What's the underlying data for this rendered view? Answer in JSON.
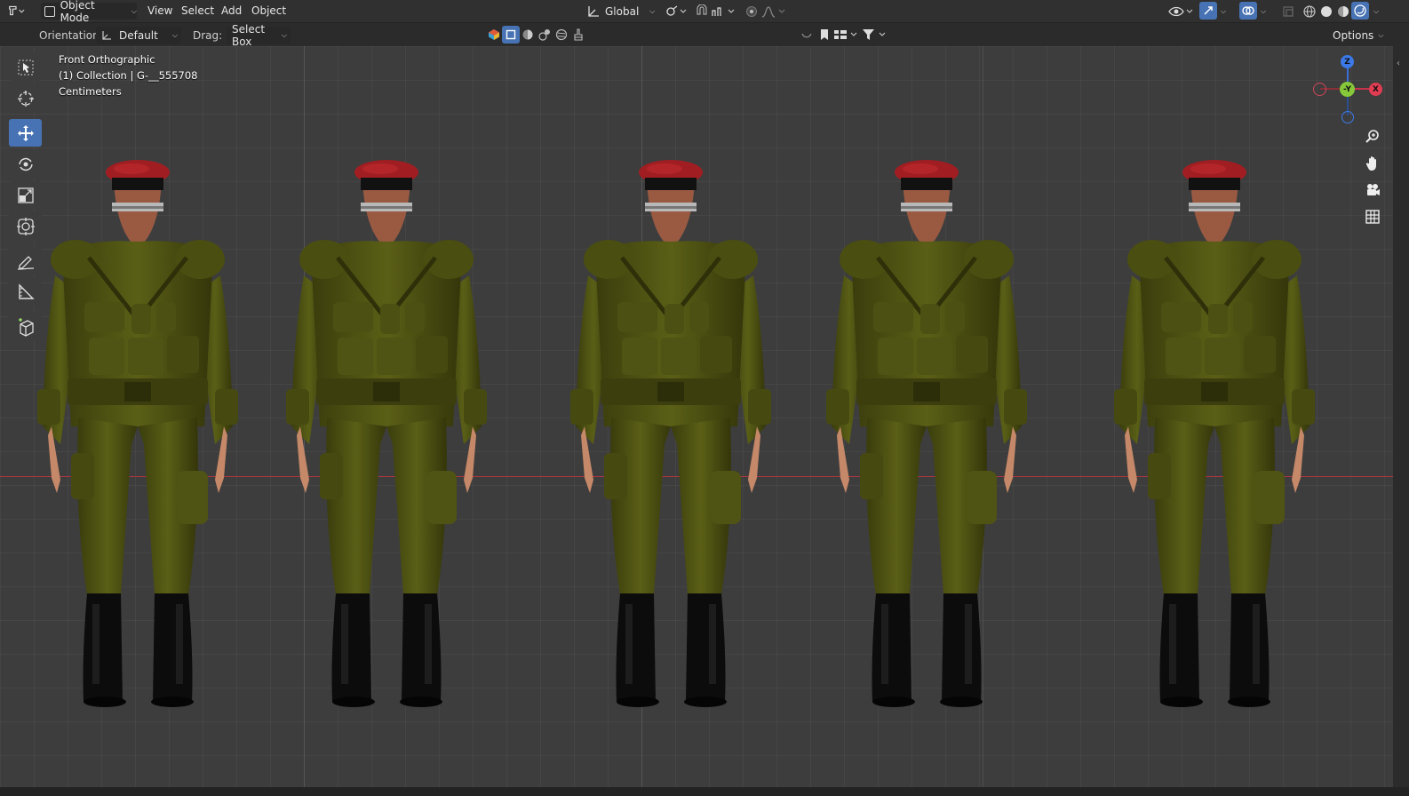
{
  "header": {
    "mode_label": "Object Mode",
    "menus": [
      "View",
      "Select",
      "Add",
      "Object"
    ],
    "transform_orientation": "Global",
    "options_label": "Options"
  },
  "toolbar": {
    "orientation_label": "Orientation:",
    "orientation_value": "Default",
    "drag_label": "Drag:",
    "drag_value": "Select Box",
    "search_value": ""
  },
  "viewport": {
    "view_name": "Front Orthographic",
    "collection_info": "(1) Collection | G-__555708",
    "units": "Centimeters"
  },
  "gizmo": {
    "z": "Z",
    "y": "-Y",
    "x": "X"
  },
  "tools": [
    "select-box",
    "cursor",
    "move",
    "rotate",
    "scale",
    "transform",
    "annotate",
    "measure",
    "add-cube"
  ],
  "colors": {
    "active_tool": "#4772b3",
    "x_axis": "#b2363e",
    "beret": "#a01e22",
    "uniform": "#4e5212",
    "boots": "#0c0c0c"
  },
  "soldiers_count": 5
}
